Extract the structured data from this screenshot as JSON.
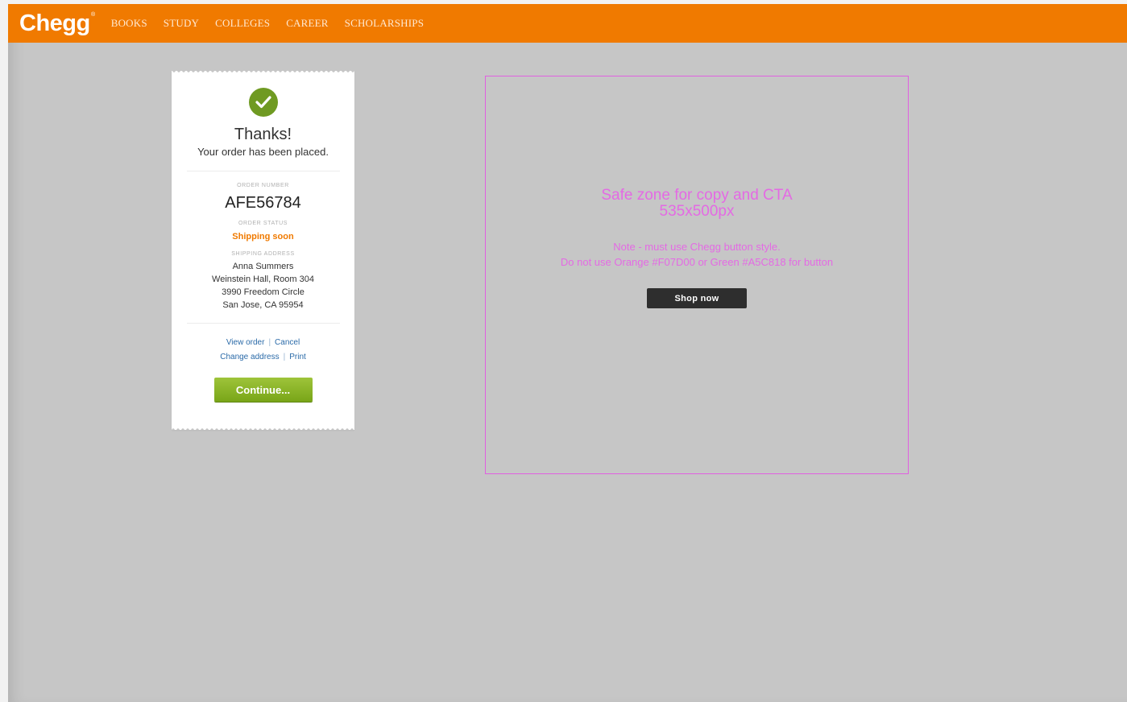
{
  "header": {
    "logo": "Chegg",
    "logo_mark": "®",
    "nav": [
      "BOOKS",
      "STUDY",
      "COLLEGES",
      "CAREER",
      "SCHOLARSHIPS"
    ]
  },
  "receipt": {
    "icon": "checkmark-circle-icon",
    "title": "Thanks!",
    "subtitle": "Your order has been placed.",
    "order_number_label": "ORDER NUMBER",
    "order_number": "AFE56784",
    "order_status_label": "ORDER STATUS",
    "order_status": "Shipping soon",
    "shipping_address_label": "SHIPPING ADDRESS",
    "address_lines": [
      "Anna Summers",
      "Weinstein Hall, Room 304",
      "3990 Freedom Circle",
      "San Jose, CA 95954"
    ],
    "links": {
      "view_order": "View order",
      "cancel": "Cancel",
      "change_address": "Change address",
      "print": "Print",
      "separator": "|"
    },
    "continue_label": "Continue..."
  },
  "safe_zone": {
    "title_line1": "Safe zone for copy and CTA",
    "title_line2": "535x500px",
    "note_line1": "Note - must use Chegg button style.",
    "note_line2": "Do not use Orange #F07D00 or Green #A5C818 for button",
    "cta_label": "Shop now"
  },
  "colors": {
    "brand_orange": "#f07a00",
    "check_green": "#6f9a22",
    "button_green": "#8bb52a",
    "safe_zone_magenta": "#e46ae4",
    "background": "#c6c6c6"
  }
}
